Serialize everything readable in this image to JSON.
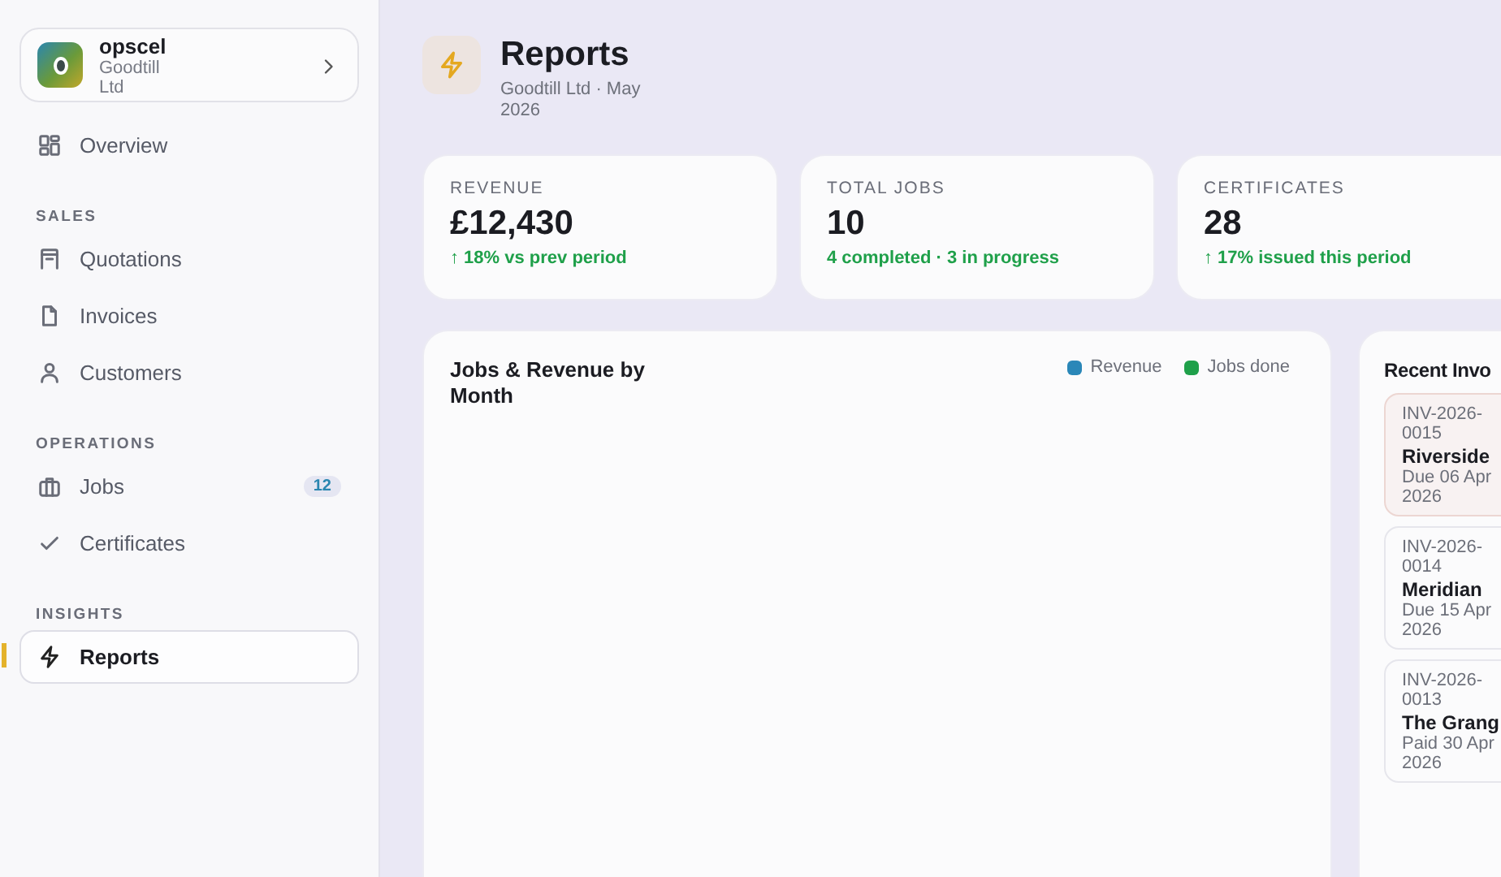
{
  "workspace": {
    "name": "opscel",
    "company": "Goodtill Ltd"
  },
  "sidebar": {
    "sections": [
      {
        "items": [
          {
            "label": "Overview",
            "selected": false
          }
        ]
      },
      {
        "heading": "SALES",
        "items": [
          {
            "label": "Quotations",
            "selected": false
          },
          {
            "label": "Invoices",
            "selected": false
          },
          {
            "label": "Customers",
            "selected": false
          }
        ]
      },
      {
        "heading": "OPERATIONS",
        "items": [
          {
            "label": "Jobs",
            "selected": false,
            "badge": "12"
          },
          {
            "label": "Certificates",
            "selected": false
          }
        ]
      },
      {
        "heading": "INSIGHTS",
        "items": [
          {
            "label": "Reports",
            "selected": true
          }
        ]
      }
    ]
  },
  "header": {
    "title": "Reports",
    "subtitle": "Goodtill Ltd · May 2026"
  },
  "stats": [
    {
      "label": "REVENUE",
      "value": "£12,430",
      "note": "↑ 18% vs prev period"
    },
    {
      "label": "TOTAL JOBS",
      "value": "10",
      "note": "4 completed · 3 in progress"
    },
    {
      "label": "CERTIFICATES",
      "value": "28",
      "note": "↑ 17% issued this period"
    }
  ],
  "chart_panel": {
    "title": "Jobs & Revenue by Month",
    "legend": [
      {
        "label": "Revenue",
        "color": "#2a87b8"
      },
      {
        "label": "Jobs done",
        "color": "#1fa04a"
      }
    ]
  },
  "invoices_panel": {
    "title": "Recent Invo",
    "items": [
      {
        "number": "INV-2026-0015",
        "customer": "Riverside",
        "date": "Due 06 Apr 2026",
        "overdue": true
      },
      {
        "number": "INV-2026-0014",
        "customer": "Meridian",
        "date": "Due 15 Apr 2026",
        "overdue": false
      },
      {
        "number": "INV-2026-0013",
        "customer": "The Grang",
        "date": "Paid 30 Apr 2026",
        "overdue": false
      }
    ]
  }
}
